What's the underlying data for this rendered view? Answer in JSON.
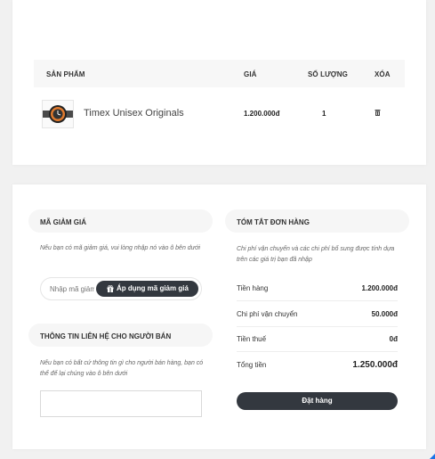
{
  "cart": {
    "headers": {
      "product": "SẢN PHẨM",
      "price": "GIÁ",
      "quantity": "SỐ LƯỢNG",
      "remove": "XÓA"
    },
    "items": [
      {
        "name": "Timex Unisex Originals",
        "price": "1.200.000đ",
        "quantity": "1",
        "thumb_icon": "watch-icon",
        "remove_icon": "trash-icon"
      }
    ]
  },
  "coupon": {
    "title": "MÃ GIẢM GIÁ",
    "note": "Nếu bạn có mã giảm giá, vui lòng nhập nó vào ô bên dưới",
    "placeholder": "Nhập mã giảm giá",
    "apply_label": "Áp dụng mã giảm giá",
    "apply_icon": "gift-icon"
  },
  "seller_contact": {
    "title": "THÔNG TIN LIÊN HỆ CHO NGƯỜI BÁN",
    "note": "Nếu bạn có bất cứ thông tin gì cho người bán hàng, bạn có thể để lại chúng vào ô bên dưới",
    "value": ""
  },
  "summary": {
    "title": "TÓM TẮT ĐƠN HÀNG",
    "note": "Chi phí vận chuyển và các chi phí bổ sung được tính dựa trên các giá trị bạn đã nhập",
    "rows": [
      {
        "label": "Tiền hàng",
        "value": "1.200.000đ"
      },
      {
        "label": "Chi phí vận chuyển",
        "value": "50.000đ"
      },
      {
        "label": "Tiền thuế",
        "value": "0đ"
      }
    ],
    "total_label": "Tổng tiền",
    "total_value": "1.250.000đ",
    "order_button": "Đặt hàng"
  },
  "colors": {
    "dark_button": "#33383f",
    "pill_bg": "#f6f6f6",
    "page_bg": "#f1f1f1",
    "accent": "#1a73e8"
  }
}
